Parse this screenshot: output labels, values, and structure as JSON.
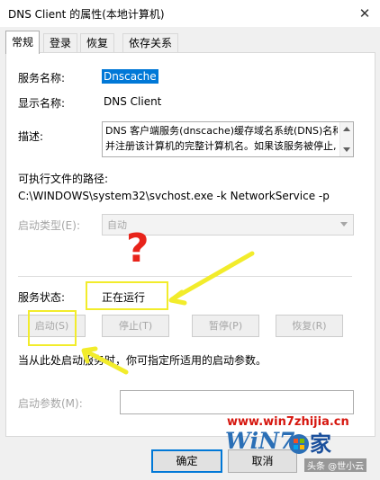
{
  "window": {
    "title": "DNS Client 的属性(本地计算机)"
  },
  "tabs": [
    {
      "label": "常规"
    },
    {
      "label": "登录"
    },
    {
      "label": "恢复"
    },
    {
      "label": "依存关系"
    }
  ],
  "general": {
    "service_name_label": "服务名称:",
    "service_name_value": "Dnscache",
    "display_name_label": "显示名称:",
    "display_name_value": "DNS Client",
    "description_label": "描述:",
    "description_line1": "DNS 客户端服务(dnscache)缓存域名系统(DNS)名称",
    "description_line2": "并注册该计算机的完整计算机名。如果该服务被停止,",
    "path_label": "可执行文件的路径:",
    "path_value": "C:\\WINDOWS\\system32\\svchost.exe -k NetworkService -p",
    "startup_type_label": "启动类型(E):",
    "startup_type_value": "自动",
    "status_label": "服务状态:",
    "status_value": "正在运行",
    "start_button": "启动(S)",
    "stop_button": "停止(T)",
    "pause_button": "暂停(P)",
    "resume_button": "恢复(R)",
    "hint_text": "当从此处启动服务时，你可指定所适用的启动参数。",
    "start_params_label": "启动参数(M):",
    "start_params_value": ""
  },
  "footer": {
    "ok_button": "确定",
    "cancel_button": "取消"
  },
  "annotation": {
    "question_mark": "?",
    "color": "#f2ec2b",
    "question_color": "#e8231a"
  },
  "watermark": {
    "url": "www.win7zhijia.cn",
    "brand": "WiN7",
    "brand_suffix": "家",
    "credit": "头条 @世小云"
  },
  "colors": {
    "accent": "#0078d7",
    "disabled": "#a6a6a6",
    "watermark_red": "#d6160e"
  }
}
